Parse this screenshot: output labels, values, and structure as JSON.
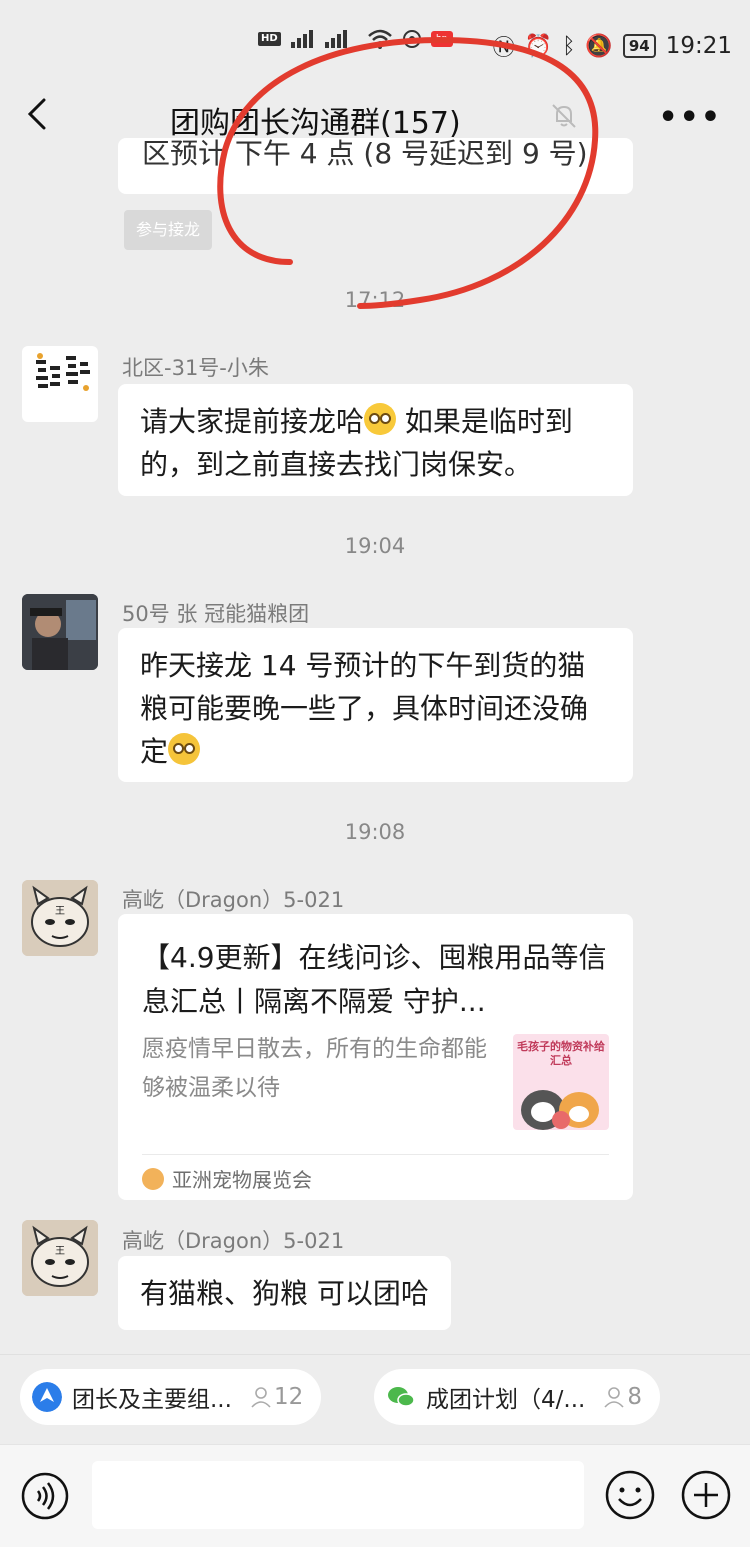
{
  "status_bar": {
    "network_left": "HD 1 4G HD 2",
    "battery": "94",
    "time": "19:21"
  },
  "header": {
    "title": "团购团长沟通群(157)",
    "back_icon": "chevron-left-icon",
    "mute_icon": "bell-off-icon",
    "more_icon": "more-horizontal-icon"
  },
  "chat": {
    "prev_fragment": "区预计 下午 4 点 (8 号延迟到 9 号)",
    "jielong_button": "参与接龙",
    "timestamps": [
      "17:12",
      "19:04",
      "19:08"
    ],
    "messages": [
      {
        "sender": "北区-31号-小朱",
        "text_a": "请大家提前接龙哈",
        "text_b": " 如果是临时到的，到之前直接去找门岗保安。",
        "emoji": "pleading-face"
      },
      {
        "sender": "50号 张 冠能猫粮团",
        "text_a": "昨天接龙 14 号预计的下午到货的猫粮可能要晚一些了，具体时间还没确定",
        "emoji": "sobbing-face"
      },
      {
        "sender": "高屹（Dragon）5-021",
        "card": {
          "title": "【4.9更新】在线问诊、囤粮用品等信息汇总丨隔离不隔爱 守护...",
          "description": "愿疫情早日散去，所有的生命都能够被温柔以待",
          "thumbnail_text": "毛孩子的物资补给汇总",
          "source": "亚洲宠物展览会"
        }
      },
      {
        "sender": "高屹（Dragon）5-021",
        "text_a": "有猫粮、狗粮 可以团哈"
      }
    ]
  },
  "pinned": [
    {
      "label": "团长及主要组...",
      "count": "12",
      "icon_color": "#2b7de9"
    },
    {
      "label": "成团计划（4/...",
      "count": "8",
      "icon_color": "#4cb84c"
    }
  ],
  "input": {
    "placeholder": "",
    "voice_icon": "voice-icon",
    "emoji_icon": "smile-icon",
    "plus_icon": "plus-circle-icon"
  }
}
